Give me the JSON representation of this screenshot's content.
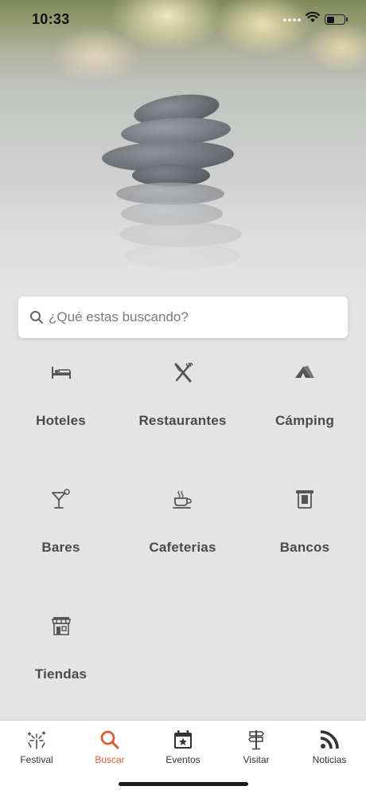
{
  "status_bar": {
    "time": "10:33"
  },
  "search": {
    "placeholder": "¿Qué estas buscando?"
  },
  "categories": [
    {
      "label": "Hoteles",
      "icon": "bed-icon"
    },
    {
      "label": "Restaurantes",
      "icon": "fork-knife-icon"
    },
    {
      "label": "Cámping",
      "icon": "tent-icon"
    },
    {
      "label": "Bares",
      "icon": "cocktail-icon"
    },
    {
      "label": "Cafeterias",
      "icon": "coffee-cup-icon"
    },
    {
      "label": "Bancos",
      "icon": "atm-icon"
    },
    {
      "label": "Tiendas",
      "icon": "store-icon"
    }
  ],
  "tab_bar": {
    "active_tab": "Buscar",
    "accent_color": "#e05a2b",
    "tabs": [
      {
        "label": "Festival",
        "icon": "fireworks-icon"
      },
      {
        "label": "Buscar",
        "icon": "search-icon"
      },
      {
        "label": "Eventos",
        "icon": "calendar-star-icon"
      },
      {
        "label": "Visitar",
        "icon": "signpost-icon"
      },
      {
        "label": "Noticias",
        "icon": "rss-icon"
      }
    ]
  }
}
